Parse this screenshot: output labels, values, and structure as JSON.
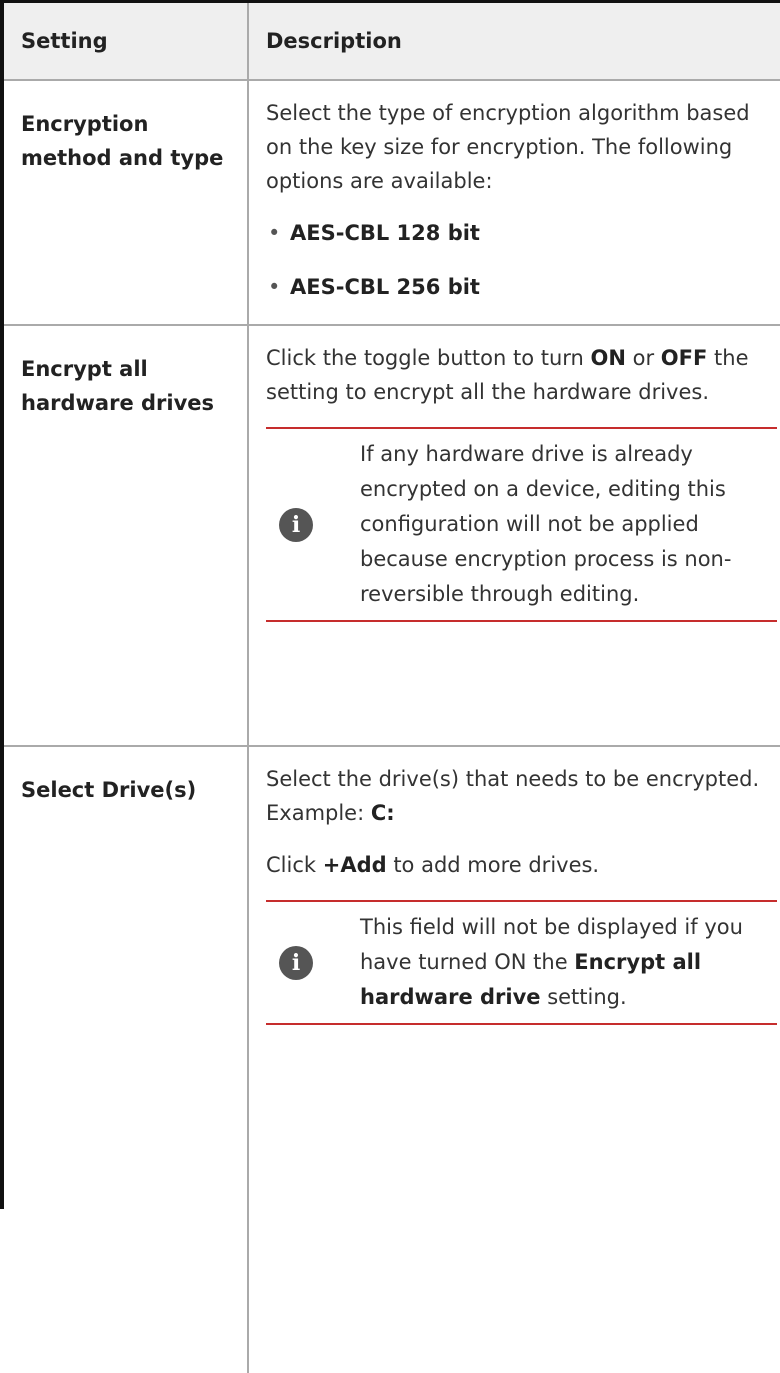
{
  "table": {
    "headers": {
      "setting": "Setting",
      "description": "Description"
    },
    "rows": [
      {
        "setting": "Encryption method and type",
        "desc_text": "Select the type of encryption algorithm based on the key size for encryption. The following options are available:",
        "options": [
          "AES-CBL 128 bit",
          "AES-CBL 256 bit"
        ]
      },
      {
        "setting": "Encrypt all hardware drives",
        "desc_pre": "Click the toggle button to turn ",
        "desc_on": "ON",
        "desc_mid": " or ",
        "desc_off": "OFF",
        "desc_post": " the setting to encrypt all the hardware drives.",
        "note": "If any hardware drive is already encrypted on a device, editing this configuration will not be applied because encryption process is non-reversible through editing."
      },
      {
        "setting": "Select Drive(s)",
        "desc_pre": "Select the drive(s) that needs to be encrypted. Example: ",
        "desc_example": "C:",
        "add_pre": "Click ",
        "add_label": "+Add",
        "add_post": " to add more drives.",
        "note_pre": "This field will not be displayed if you have turned ON the ",
        "note_bold": "Encrypt all hardware drive",
        "note_post": " setting."
      }
    ]
  },
  "icons": {
    "note_icon": "info-icon"
  },
  "colors": {
    "note_rule": "#c62d2d",
    "header_bg": "#efefef",
    "icon_bg": "#555555"
  }
}
